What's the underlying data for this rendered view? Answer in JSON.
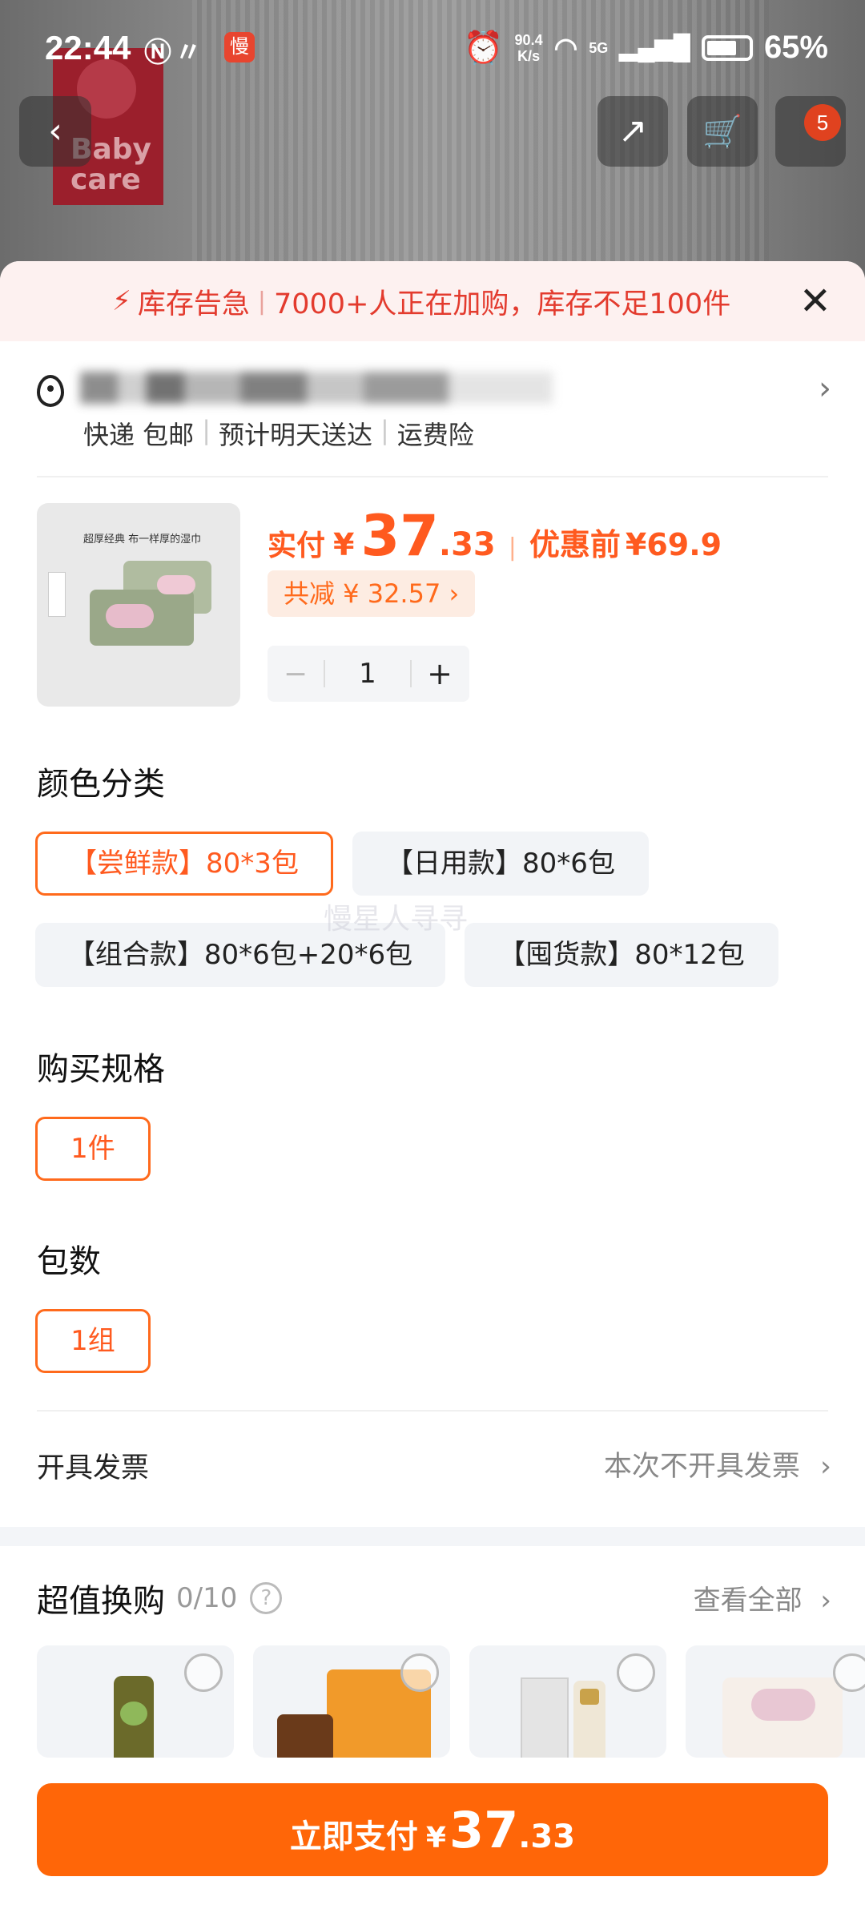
{
  "status_bar": {
    "time": "22:44",
    "net_speed": "90.4",
    "net_unit": "K/s",
    "signal": "5G",
    "battery": "65%",
    "slow_badge": "慢"
  },
  "nav": {
    "back_icon": "‹",
    "share_icon": "↗",
    "cart_icon": "🛒",
    "message_badge": "5"
  },
  "background": {
    "logo_text": "Baby care"
  },
  "alert": {
    "title": "库存告急",
    "message": "7000+人正在加购，库存不足100件",
    "close": "✕"
  },
  "address": {
    "delivery": "快递 包邮",
    "eta": "预计明天送达",
    "insurance": "运费险"
  },
  "product": {
    "thumb_caption": "超厚经典 布一样厚的湿巾",
    "price_prefix": "实付",
    "yen": "¥",
    "price_int": "37",
    "price_dec": ".33",
    "orig_label": "优惠前",
    "orig_price": "¥69.9",
    "discount": "共减 ¥ 32.57 ›",
    "quantity": "1",
    "minus": "−",
    "plus": "+"
  },
  "sections": {
    "color": "颜色分类",
    "spec": "购买规格",
    "packs": "包数"
  },
  "color_options": [
    {
      "label": "【尝鲜款】80*3包",
      "selected": true
    },
    {
      "label": "【日用款】80*6包",
      "selected": false
    },
    {
      "label": "【组合款】80*6包+20*6包",
      "selected": false
    },
    {
      "label": "【囤货款】80*12包",
      "selected": false
    }
  ],
  "spec_options": [
    {
      "label": "1件",
      "selected": true
    }
  ],
  "pack_options": [
    {
      "label": "1组",
      "selected": true
    }
  ],
  "watermark": "慢星人寻寻",
  "invoice": {
    "label": "开具发票",
    "value": "本次不开具发票"
  },
  "upsell": {
    "title": "超值换购",
    "count": "0/10",
    "view_all": "查看全部"
  },
  "pay": {
    "label": "立即支付",
    "yen": "¥",
    "int": "37",
    "dec": ".33"
  },
  "colors": {
    "accent": "#ff6608",
    "alert_red": "#e33b2e",
    "chip_bg": "#f2f4f7"
  }
}
